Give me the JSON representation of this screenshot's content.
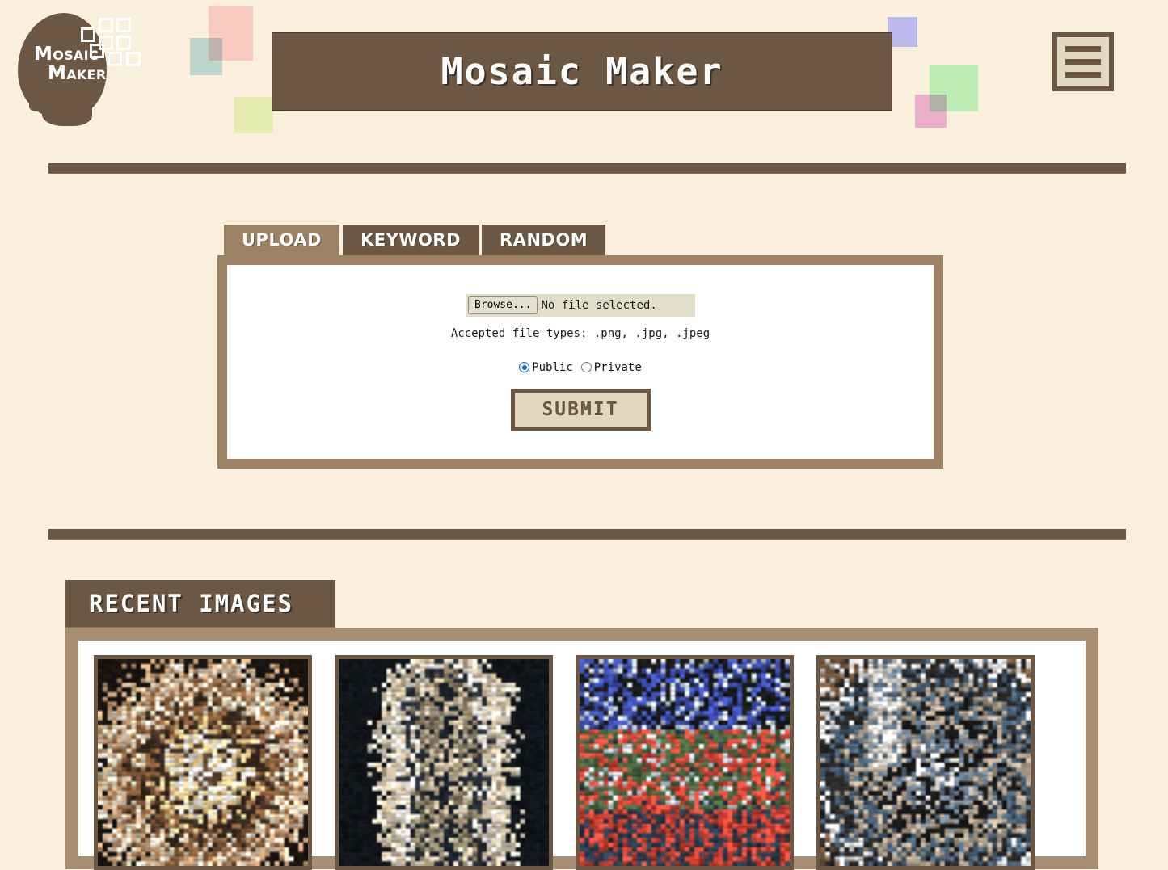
{
  "brand": {
    "logo_line1": "Mosaic",
    "logo_line2": "Maker",
    "logo_icon": "head-silhouette-with-pixel-grid"
  },
  "header": {
    "title": "Mosaic Maker",
    "menu_icon": "hamburger-menu-icon"
  },
  "tabs": [
    {
      "label": "UPLOAD",
      "active": true
    },
    {
      "label": "KEYWORD",
      "active": false
    },
    {
      "label": "RANDOM",
      "active": false
    }
  ],
  "upload": {
    "browse_label": "Browse...",
    "file_status": "No file selected.",
    "accepted_types": "Accepted file types: .png, .jpg, .jpeg",
    "visibility": [
      {
        "label": "Public",
        "selected": true
      },
      {
        "label": "Private",
        "selected": false
      }
    ],
    "submit_label": "SUBMIT"
  },
  "recent": {
    "title": "RECENT IMAGES",
    "thumbnails": [
      {
        "alt": "mosaic-teddy-bear-face",
        "palette": [
          "#1a1512",
          "#c9a27a",
          "#f2e3c8",
          "#8a5f3c",
          "#3a2b20",
          "#e8c98f",
          "#ffffff",
          "#5c4530"
        ],
        "bg": "#241c16",
        "scene": "warm-brown-bear-face-on-dark"
      },
      {
        "alt": "mosaic-light-figure-on-dark",
        "palette": [
          "#12161c",
          "#e8ddc9",
          "#c9b99c",
          "#f5efe2",
          "#2a2f38",
          "#8f8268",
          "#d8c9ad",
          "#1c222b"
        ],
        "bg": "#151a22",
        "scene": "pale-statue-figure-on-near-black"
      },
      {
        "alt": "mosaic-red-car-landscape",
        "palette": [
          "#9fd4ec",
          "#c0392b",
          "#2c3e50",
          "#e74c3c",
          "#4a6741",
          "#d6e9f5",
          "#1a1a1a",
          "#3f51b5"
        ],
        "bg": "#1d2430",
        "scene": "blue-sky-red-car-green-grass"
      },
      {
        "alt": "mosaic-cat-with-white-column",
        "palette": [
          "#7a5c42",
          "#ffffff",
          "#2b2b2b",
          "#4a6278",
          "#b8a894",
          "#1a1a1a",
          "#6b7f92",
          "#e8e4dc"
        ],
        "bg": "#2a2520",
        "scene": "grey-cat-with-bright-white-stripe"
      }
    ]
  },
  "colors": {
    "page_bg": "#faeedc",
    "brown_dark": "#6b5743",
    "brown_mid": "#9d8165",
    "brown_light": "#a78d71",
    "tan": "#e2d8bf",
    "accent_blue": "#1163c9"
  },
  "decorations": [
    {
      "name": "pink-square",
      "color": "#f9cac0"
    },
    {
      "name": "blue-square",
      "color": "#c2e4ec"
    },
    {
      "name": "yellow-square",
      "color": "#e5eeb0"
    },
    {
      "name": "lavender-square",
      "color": "#bcb9ec"
    },
    {
      "name": "green-square",
      "color": "#bdedb4"
    },
    {
      "name": "magenta-square",
      "color": "#f0bced"
    }
  ]
}
